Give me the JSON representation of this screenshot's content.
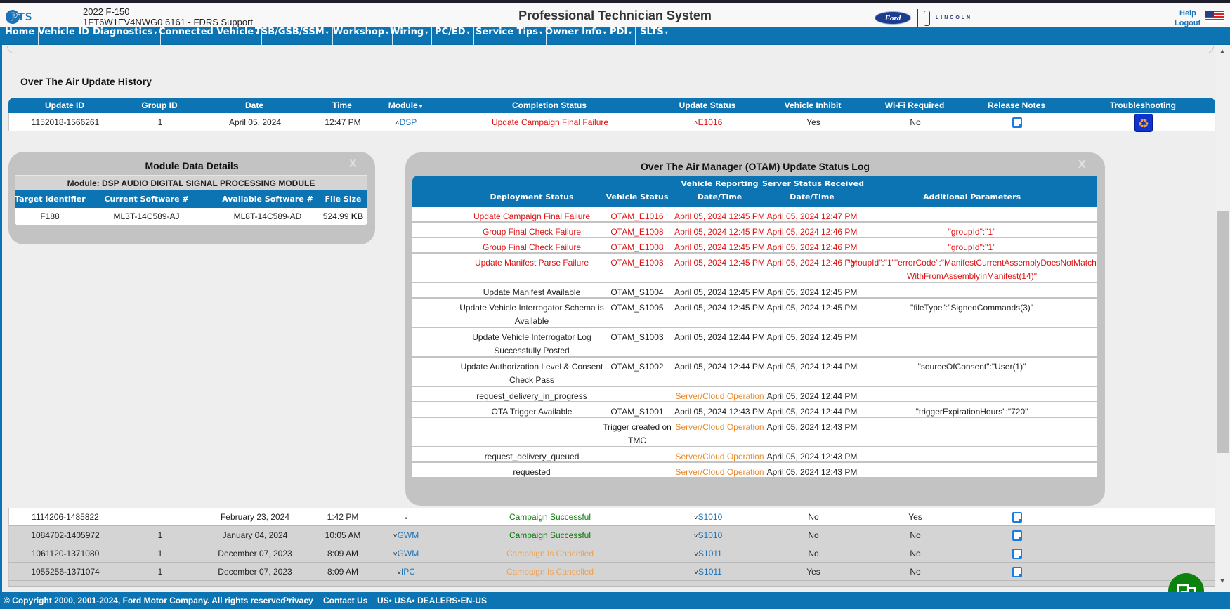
{
  "header": {
    "logo": "PTS",
    "vehicle_model": "2022 F-150",
    "vehicle_vin": "1FT6W1EV4NWG0 6161 - FDRS Support",
    "app_title": "Professional Technician System",
    "brand_ford": "Ford",
    "brand_lincoln": "LINCOLN",
    "help": "Help",
    "logout": "Logout"
  },
  "nav": [
    {
      "label": "Home",
      "dropdown": false
    },
    {
      "label": "Vehicle ID",
      "dropdown": false
    },
    {
      "label": "Diagnostics",
      "dropdown": true
    },
    {
      "label": "Connected Vehicle",
      "dropdown": true
    },
    {
      "label": "TSB/GSB/SSM",
      "dropdown": true
    },
    {
      "label": "Workshop",
      "dropdown": true
    },
    {
      "label": "Wiring",
      "dropdown": true
    },
    {
      "label": "PC/ED",
      "dropdown": true
    },
    {
      "label": "Service Tips",
      "dropdown": true
    },
    {
      "label": "Owner Info",
      "dropdown": true
    },
    {
      "label": "PDI",
      "dropdown": true
    },
    {
      "label": "SLTS",
      "dropdown": true
    }
  ],
  "history": {
    "title": "Over The Air Update History",
    "columns": [
      "Update ID",
      "Group ID",
      "Date",
      "Time",
      "Module",
      "Completion Status",
      "Update Status",
      "Vehicle Inhibit",
      "Wi-Fi Required",
      "Release Notes",
      "Troubleshooting"
    ],
    "module_sort_indicator": "▾",
    "expanded_row": {
      "update_id": "1152018-1566261",
      "group_id": "1",
      "date": "April 05, 2024",
      "time": "12:47 PM",
      "module": "DSP",
      "completion_status": "Update Campaign Final Failure",
      "completion_color": "red",
      "update_status": "E1016",
      "update_color": "red",
      "vehicle_inhibit": "Yes",
      "wifi_required": "No"
    },
    "rows": [
      {
        "update_id": "1114206-1485822",
        "group_id": "",
        "date": "February 23, 2024",
        "time": "1:42 PM",
        "module": "",
        "completion_status": "Campaign Successful",
        "completion_color": "green",
        "update_status": "S1010",
        "vehicle_inhibit": "No",
        "wifi_required": "Yes"
      },
      {
        "update_id": "1084702-1405972",
        "group_id": "1",
        "date": "January 04, 2024",
        "time": "10:05 AM",
        "module": "GWM",
        "completion_status": "Campaign Successful",
        "completion_color": "green",
        "update_status": "S1010",
        "vehicle_inhibit": "No",
        "wifi_required": "No"
      },
      {
        "update_id": "1061120-1371080",
        "group_id": "1",
        "date": "December 07, 2023",
        "time": "8:09 AM",
        "module": "GWM",
        "completion_status": "Campaign Is Cancelled",
        "completion_color": "orange",
        "update_status": "S1011",
        "vehicle_inhibit": "No",
        "wifi_required": "No"
      },
      {
        "update_id": "1055256-1371074",
        "group_id": "1",
        "date": "December 07, 2023",
        "time": "8:09 AM",
        "module": "IPC",
        "completion_status": "Campaign Is Cancelled",
        "completion_color": "orange",
        "update_status": "S1011",
        "vehicle_inhibit": "Yes",
        "wifi_required": "No"
      }
    ]
  },
  "module_details": {
    "title": "Module Data Details",
    "close": "X",
    "module_label": "Module: DSP AUDIO DIGITAL SIGNAL PROCESSING MODULE",
    "columns": [
      "Target Identifier",
      "Current Software #",
      "Available Software #",
      "File Size"
    ],
    "row": {
      "target": "F188",
      "current": "ML3T-14C589-AJ",
      "available": "ML8T-14C589-AD",
      "size": "524.99",
      "unit": "KB"
    }
  },
  "otam": {
    "title": "Over The Air Manager (OTAM) Update Status Log",
    "close": "X",
    "columns": {
      "deployment": "Deployment Status",
      "vehicle_status": "Vehicle Status",
      "vehicle_reporting_1": "Vehicle Reporting",
      "vehicle_reporting_2": "Date/Time",
      "server_received_1": "Server Status Received",
      "server_received_2": "Date/Time",
      "params": "Additional Parameters"
    },
    "rows": [
      {
        "deployment": "Update Campaign Final Failure",
        "vstatus": "OTAM_E1016",
        "vtime": "April 05, 2024 12:45 PM",
        "stime": "April 05, 2024 12:47 PM",
        "params": "",
        "color": "red",
        "tall": false
      },
      {
        "deployment": "Group Final Check Failure",
        "vstatus": "OTAM_E1008",
        "vtime": "April 05, 2024 12:45 PM",
        "stime": "April 05, 2024 12:46 PM",
        "params": "\"groupId\":\"1\"",
        "color": "red",
        "tall": false
      },
      {
        "deployment": "Group Final Check Failure",
        "vstatus": "OTAM_E1008",
        "vtime": "April 05, 2024 12:45 PM",
        "stime": "April 05, 2024 12:46 PM",
        "params": "\"groupId\":\"1\"",
        "color": "red",
        "tall": false
      },
      {
        "deployment": "Update Manifest Parse Failure",
        "vstatus": "OTAM_E1003",
        "vtime": "April 05, 2024 12:45 PM",
        "stime": "April 05, 2024 12:46 PM",
        "params": "\"groupId\":\"1\"\"errorCode\":\"ManifestCurrentAssemblyDoesNotMatchWithFromAssemblyInManifest(14)\"",
        "color": "red",
        "tall": true
      },
      {
        "deployment": "Update Manifest Available",
        "vstatus": "OTAM_S1004",
        "vtime": "April 05, 2024 12:45 PM",
        "stime": "April 05, 2024 12:45 PM",
        "params": "",
        "color": "normal",
        "tall": false
      },
      {
        "deployment": "Update Vehicle Interrogator Schema is Available",
        "vstatus": "OTAM_S1005",
        "vtime": "April 05, 2024 12:45 PM",
        "stime": "April 05, 2024 12:45 PM",
        "params": "\"fileType\":\"SignedCommands(3)\"",
        "color": "normal",
        "tall": true
      },
      {
        "deployment": "Update Vehicle Interrogator Log Successfully Posted",
        "vstatus": "OTAM_S1003",
        "vtime": "April 05, 2024 12:44 PM",
        "stime": "April 05, 2024 12:45 PM",
        "params": "",
        "color": "normal",
        "tall": true
      },
      {
        "deployment": "Update Authorization Level & Consent Check Pass",
        "vstatus": "OTAM_S1002",
        "vtime": "April 05, 2024 12:44 PM",
        "stime": "April 05, 2024 12:44 PM",
        "params": "\"sourceOfConsent\":\"User(1)\"",
        "color": "normal",
        "tall": true
      },
      {
        "deployment": "request_delivery_in_progress",
        "vstatus": "",
        "vtime": "Server/Cloud Operation",
        "stime": "April 05, 2024 12:44 PM",
        "params": "",
        "color": "server",
        "tall": false
      },
      {
        "deployment": "OTA Trigger Available",
        "vstatus": "OTAM_S1001",
        "vtime": "April 05, 2024 12:43 PM",
        "stime": "April 05, 2024 12:44 PM",
        "params": "\"triggerExpirationHours\":\"720\"",
        "color": "normal",
        "tall": false
      },
      {
        "deployment": "",
        "vstatus": "Trigger created on TMC",
        "vtime": "Server/Cloud Operation",
        "stime": "April 05, 2024 12:43 PM",
        "params": "",
        "color": "server",
        "tall": true
      },
      {
        "deployment": "request_delivery_queued",
        "vstatus": "",
        "vtime": "Server/Cloud Operation",
        "stime": "April 05, 2024 12:43 PM",
        "params": "",
        "color": "server",
        "tall": false
      },
      {
        "deployment": "requested",
        "vstatus": "",
        "vtime": "Server/Cloud Operation",
        "stime": "April 05, 2024 12:43 PM",
        "params": "",
        "color": "server",
        "tall": false
      }
    ]
  },
  "footer": {
    "copyright": "© Copyright 2000, 2001-2024, Ford Motor Company. All rights reserved",
    "privacy": "Privacy",
    "contact": "Contact Us",
    "locale": "US• USA• DEALERS•EN-US"
  },
  "colors": {
    "brand_blue": "#0c74b2",
    "error_red": "#e01010",
    "success_green": "#0a7a0a",
    "cancel_orange": "#f0a050",
    "server_orange": "#e88a2e",
    "chat_green": "#0b820b"
  }
}
